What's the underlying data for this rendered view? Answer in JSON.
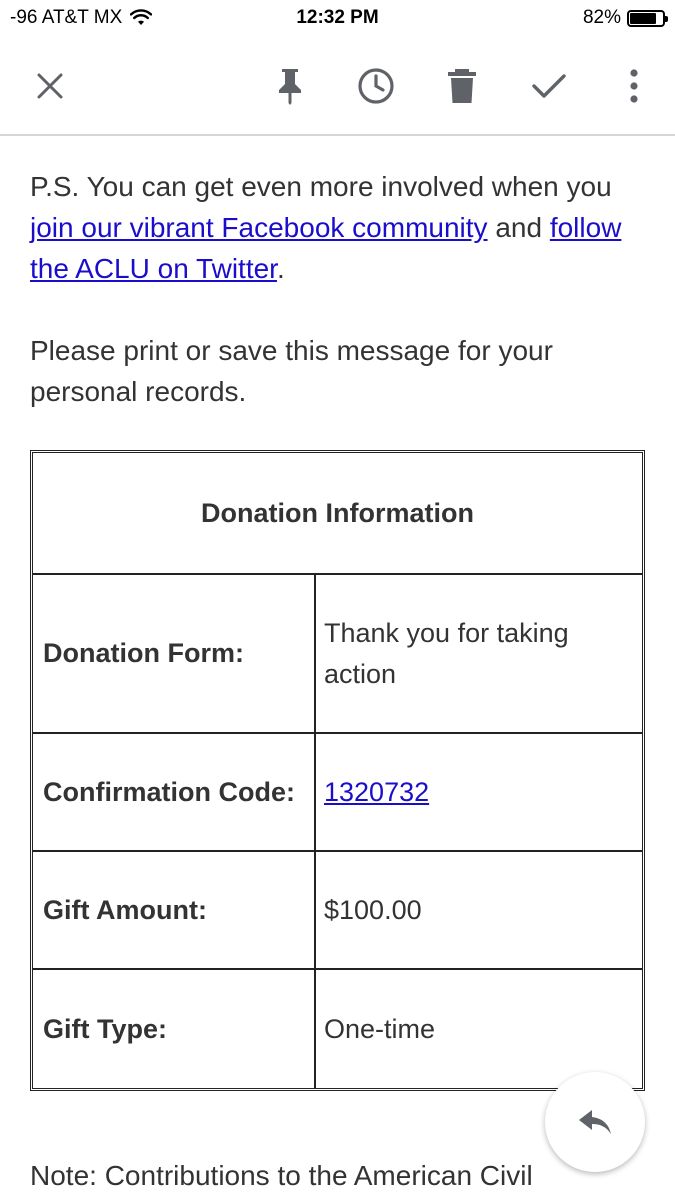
{
  "status_bar": {
    "carrier": "-96 AT&T MX",
    "time": "12:32 PM",
    "battery_percent_text": "82%",
    "battery_level": 0.82
  },
  "toolbar": {
    "icons": [
      "close-icon",
      "pin-icon",
      "snooze-clock-icon",
      "trash-icon",
      "done-check-icon",
      "more-vert-icon"
    ]
  },
  "message": {
    "ps_prefix": "P.S. You can get even more involved when you ",
    "facebook_link": "join our vibrant Facebook community",
    "middle": " and ",
    "twitter_link": "follow the ACLU on Twitter",
    "ps_suffix": ".",
    "print_note": "Please print or save this message for your personal records."
  },
  "donation_table": {
    "header": "Donation Information",
    "rows": [
      {
        "label": "Donation Form:",
        "value": "Thank you for taking action"
      },
      {
        "label": "Confirmation Code:",
        "value": "1320732"
      },
      {
        "label": "Gift Amount:",
        "value": "$100.00"
      },
      {
        "label": "Gift Type:",
        "value": "One-time"
      }
    ]
  },
  "footer_note": "Note: Contributions to the American Civil",
  "colors": {
    "link": "#1a0dcc",
    "text": "#333333",
    "icon": "#5f6368"
  }
}
